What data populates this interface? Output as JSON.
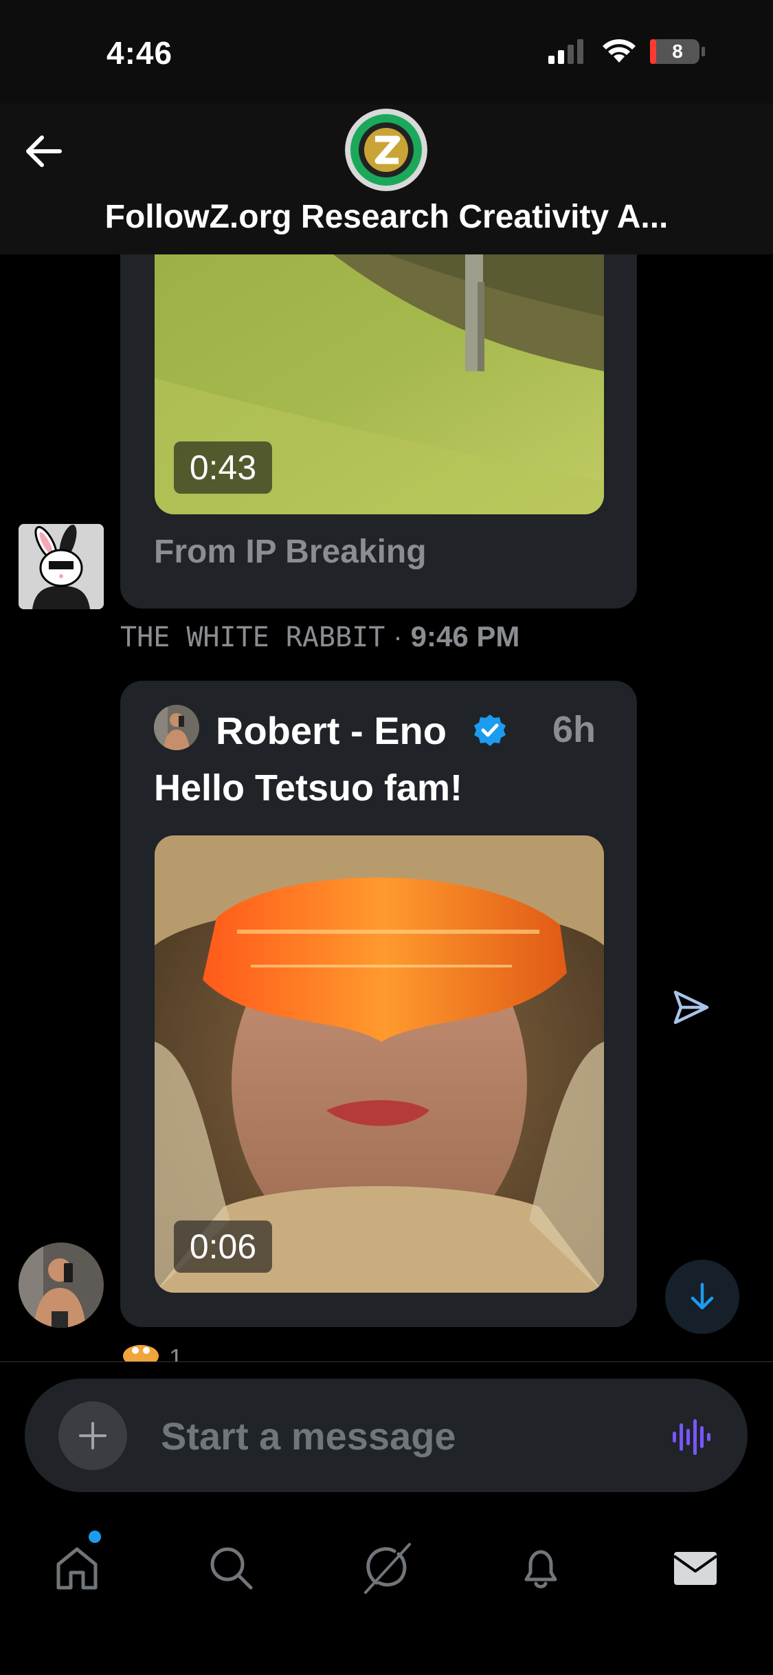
{
  "status_bar": {
    "time": "4:46",
    "battery_level": "8"
  },
  "header": {
    "title": "FollowZ.org Research Creativity A..."
  },
  "messages": [
    {
      "source_label": "From IP Breaking",
      "video_duration": "0:43",
      "sender": "THE WHITE RABBIT",
      "separator": "·",
      "timestamp": "9:46 PM"
    },
    {
      "post_author": "Robert - Eno",
      "post_age": "6h",
      "post_text": "Hello Tetsuo fam!",
      "video_duration": "0:06",
      "reaction_count": "1"
    }
  ],
  "composer": {
    "placeholder": "Start a message"
  },
  "colors": {
    "accent": "#1d9bf0",
    "card_bg": "#202327",
    "muted_text": "#8a8d91",
    "voice": "#7856ff"
  },
  "tabs": [
    {
      "name": "home",
      "icon": "home-icon",
      "has_notification_dot": true
    },
    {
      "name": "search",
      "icon": "search-icon"
    },
    {
      "name": "grok",
      "icon": "grok-icon"
    },
    {
      "name": "notifications",
      "icon": "bell-icon"
    },
    {
      "name": "messages",
      "icon": "envelope-icon"
    }
  ]
}
